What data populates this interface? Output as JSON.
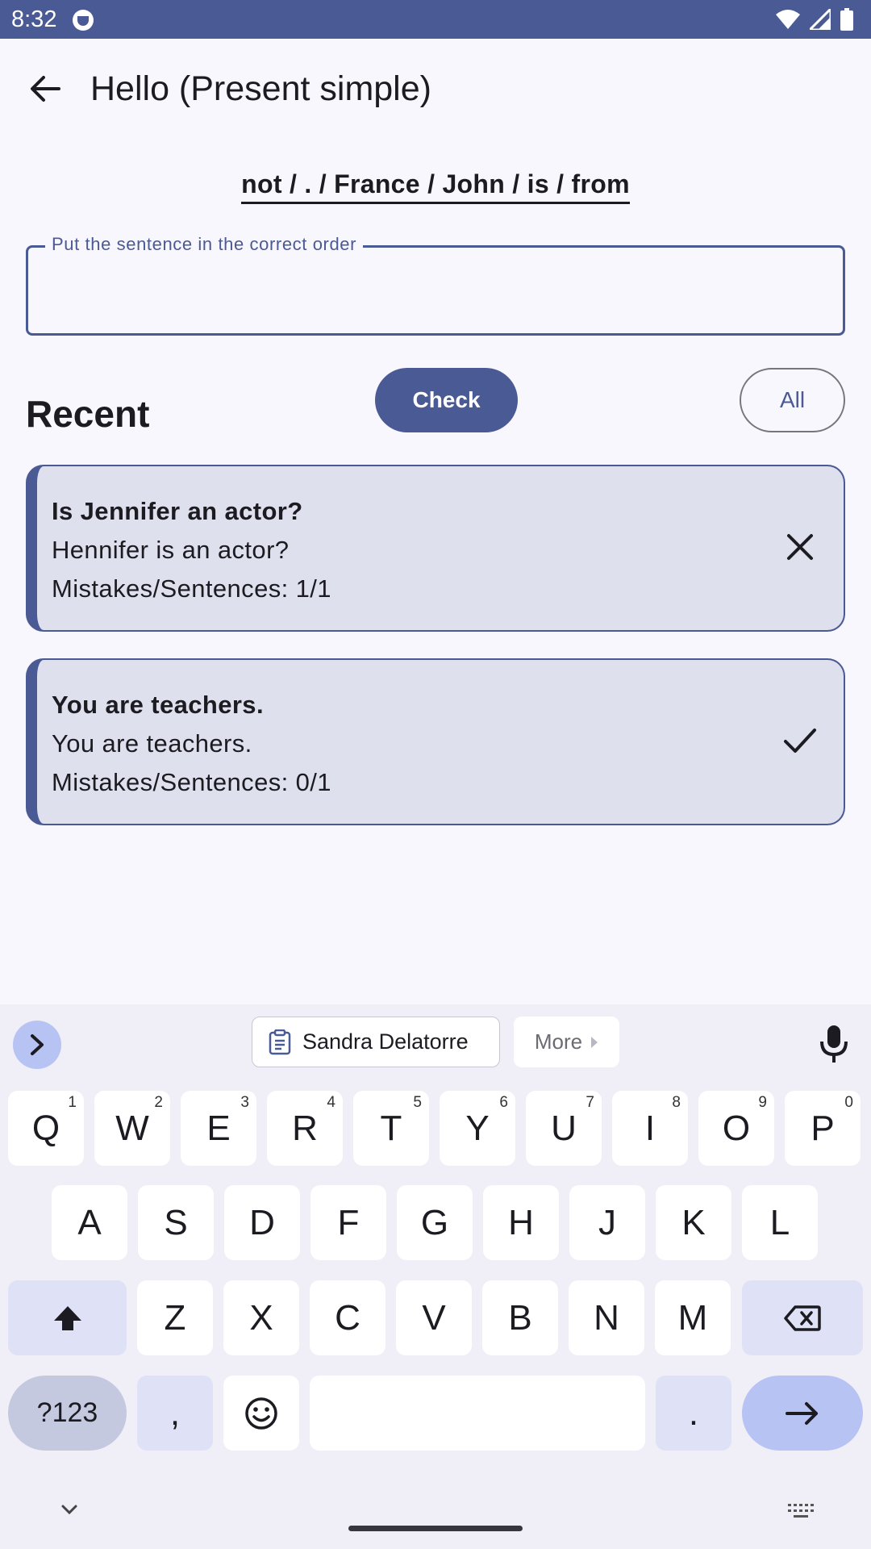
{
  "status_bar": {
    "time": "8:32"
  },
  "app_bar": {
    "title": "Hello (Present simple)"
  },
  "exercise": {
    "prompt": "not / . / France / John / is / from",
    "input_label": "Put the sentence in the correct order",
    "input_value": ""
  },
  "actions": {
    "check_label": "Check",
    "all_label": "All"
  },
  "recent": {
    "heading": "Recent",
    "items": [
      {
        "answer": "Is Jennifer an actor?",
        "user": "Hennifer is an actor?",
        "stats": "Mistakes/Sentences: 1/1",
        "result": "incorrect"
      },
      {
        "answer": "You are teachers.",
        "user": "You are teachers.",
        "stats": "Mistakes/Sentences: 0/1",
        "result": "correct"
      }
    ]
  },
  "keyboard": {
    "suggestion": "Sandra Delatorre",
    "more_label": "More",
    "row1": [
      {
        "key": "Q",
        "num": "1"
      },
      {
        "key": "W",
        "num": "2"
      },
      {
        "key": "E",
        "num": "3"
      },
      {
        "key": "R",
        "num": "4"
      },
      {
        "key": "T",
        "num": "5"
      },
      {
        "key": "Y",
        "num": "6"
      },
      {
        "key": "U",
        "num": "7"
      },
      {
        "key": "I",
        "num": "8"
      },
      {
        "key": "O",
        "num": "9"
      },
      {
        "key": "P",
        "num": "0"
      }
    ],
    "row2": [
      "A",
      "S",
      "D",
      "F",
      "G",
      "H",
      "J",
      "K",
      "L"
    ],
    "row3": [
      "Z",
      "X",
      "C",
      "V",
      "B",
      "N",
      "M"
    ],
    "symbols_label": "?123",
    "comma": ",",
    "period": "."
  },
  "colors": {
    "primary": "#4a5a94",
    "card": "#dfe0ee",
    "keyboard_bg": "#f0eff7",
    "accent_key": "#b7c3f3"
  }
}
